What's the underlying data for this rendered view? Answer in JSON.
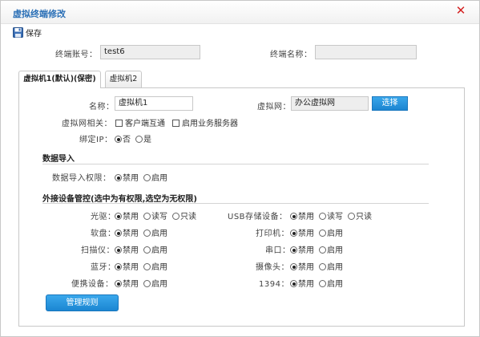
{
  "dialog": {
    "title": "虚拟终端修改",
    "close_glyph": "✕"
  },
  "toolbar": {
    "save_label": "保存"
  },
  "account": {
    "account_label": "终端账号：",
    "account_value": "test6",
    "name_label": "终端名称：",
    "name_value": ""
  },
  "tabs": [
    {
      "label": "虚拟机1(默认)(保密)",
      "active": true
    },
    {
      "label": "虚拟机2",
      "active": false
    }
  ],
  "vm": {
    "name_label": "名称：",
    "name_value": "虚拟机1",
    "network_label": "虚拟网：",
    "network_value": "办公虚拟网",
    "select_button": "选择",
    "network_related_label": "虚拟网相关：",
    "client_interop": "客户端互通",
    "enable_business_server": "启用业务服务器",
    "bind_ip_label": "绑定IP：",
    "bind_ip_no": "否",
    "bind_ip_yes": "是",
    "bind_ip_selected": "否"
  },
  "data_import": {
    "section_title": "数据导入",
    "perm_label": "数据导入权限：",
    "disable": "禁用",
    "enable": "启用",
    "selected": "禁用"
  },
  "devices": {
    "section_title": "外接设备管控(选中为有权限,选空为无权限)",
    "opt_disable": "禁用",
    "opt_enable": "启用",
    "opt_readwrite": "读写",
    "opt_readonly": "只读",
    "optical": "光驱：",
    "usb_storage": "USB存储设备：",
    "floppy": "软盘：",
    "printer": "打印机：",
    "scanner": "扫描仪：",
    "serial": "串口：",
    "bluetooth": "蓝牙：",
    "camera": "摄像头：",
    "portable": "便携设备：",
    "ieee1394": "1394："
  },
  "manage_rules_button": "管理规则",
  "colors": {
    "accent": "#2a6fb6",
    "button_blue": "#1b85d1",
    "close_red": "#d42020"
  }
}
